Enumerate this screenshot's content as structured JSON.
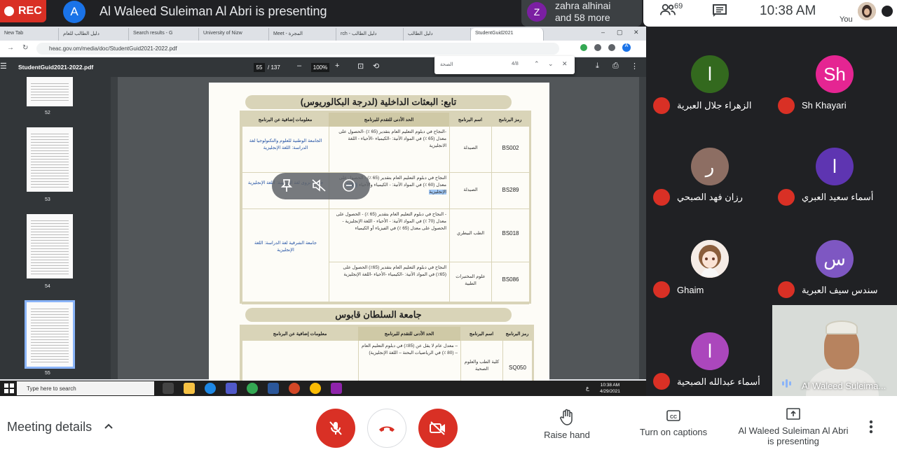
{
  "recording": {
    "label": "REC"
  },
  "presenter": {
    "initial": "A",
    "banner": "Al Waleed Suleiman Al Abri is presenting"
  },
  "others": {
    "initial": "Z",
    "line1": "zahra alhinai",
    "line2": "and 58 more"
  },
  "top_right": {
    "people_count": "69",
    "time": "10:38 AM",
    "you_label": "You"
  },
  "browser": {
    "tabs": [
      "New Tab",
      "دليل الطالب للعام",
      "Search results - G",
      "University of Nizw",
      "Meet - المجرة",
      "rch - دليل الطالب",
      "دليل الطالب",
      "StudentGuid2021"
    ],
    "url": "heac.gov.om/media/doc/StudentGuid2021-2022.pdf",
    "profile_initial": "A"
  },
  "pdf": {
    "title": "StudentGuid2021-2022.pdf",
    "page": "55",
    "page_total": "/ 137",
    "zoom": "100%",
    "find_query": "الصحة",
    "find_count": "4/8",
    "thumb_numbers": [
      "52",
      "53",
      "54",
      "55"
    ]
  },
  "doc": {
    "heading1": "تابع: البعثات الداخلية (لدرجة البكالوريوس)",
    "heading2": "جامعة السلطان قابوس",
    "col_code": "رمز البرنامج",
    "col_name": "اسم البرنامج",
    "col_min": "الحد الأدنى للتقدم للبرنامج",
    "col_info": "معلومات إضافية عن البرنامج",
    "rows": [
      {
        "code": "BS002",
        "name": "الصيدلة",
        "min": "-النجاح في دبلوم التعليم العام بتقدير (65 ٪) -الحصول على معدل (65 ٪) في المواد الآتية: -الكيمياء -الأحياء - اللغة الانجليزية",
        "info": "الجامعة الوطنية للعلوم والتكنولوجيا لغة الدراسة: اللغة الإنجليزية"
      },
      {
        "code": "BS289",
        "name": "الصيدلة",
        "min": "النجاح في دبلوم التعليم العام بتقدير (65 ٪) - الحصول على معدل (60 ٪) في المواد الآتية: - الكيمياء والأحياء",
        "min_hl": "- اللغة الإنجليزية",
        "info": "جامعة نزوى لغة الدراسة: اللغة الإنجليزية"
      },
      {
        "code": "BS018",
        "name": "الطب البيطري",
        "min": "- النجاح في دبلوم التعليم العام بتقدير (65 ٪) - الحصول على معدل (70 ٪) في المواد الآتية: - الأحياء - اللغة الإنجليزية - الحصول على معدل (65 ٪) في الفيزياء أو الكيمياء",
        "info": "جامعة الشرقية لغة الدراسة: اللغة الإنجليزية"
      },
      {
        "code": "BS086",
        "name": "علوم المختبرات الطبية",
        "min": "النجاح في دبلوم التعليم العام بتقدير (65٪) الحصول على (65٪) في المواد الآتية: -الكيمياء -الأحياء -اللغة الإنجليزية",
        "info": ""
      }
    ],
    "row2": {
      "code": "SQ050",
      "name": "كلية الطب والعلوم الصحية",
      "min": "– معدل عام لا يقل عن (85٪) في دبلوم التعليم العام – (80 ٪) في الرياضيات البحتة – اللغة الإنجليزية)"
    }
  },
  "taskbar": {
    "search_placeholder": "Type here to search",
    "time": "10:38 AM",
    "date": "4/29/2021",
    "lang": "ع"
  },
  "participants": [
    {
      "initial": "ا",
      "name": "الزهراء جلال العبرية",
      "color": "#33691e"
    },
    {
      "initial": "Sh",
      "name": "Sh Khayari",
      "color": "#e52592"
    },
    {
      "initial": "ر",
      "name": "رزان فهد الصبحي",
      "color": "#8d6e63"
    },
    {
      "initial": "ا",
      "name": "أسماء سعيد العبري",
      "color": "#5e35b1"
    },
    {
      "initial": "",
      "name": "Ghaim",
      "color": "#f3e5d8"
    },
    {
      "initial": "س",
      "name": "سندس سيف العبرية",
      "color": "#7e57c2"
    },
    {
      "initial": "ا",
      "name": "أسماء عبدالله الصبحية",
      "color": "#ab47bc"
    }
  ],
  "self_tile": {
    "name": "Al Waleed Suleima..."
  },
  "bottom": {
    "meeting_details": "Meeting details",
    "raise_hand": "Raise hand",
    "captions": "Turn on captions",
    "presenting_line1": "Al Waleed Suleiman Al Abri",
    "presenting_line2": "is presenting"
  },
  "colors": {
    "danger": "#d93025",
    "accent": "#1a73e8",
    "dark": "#202124"
  }
}
